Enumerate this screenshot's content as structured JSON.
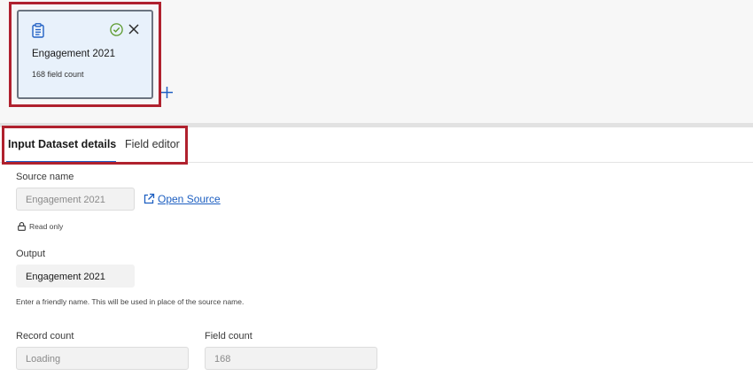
{
  "card": {
    "title": "Engagement 2021",
    "subtitle": "168 field count",
    "status_color": "#5b9a2c",
    "accent": "#2160c4"
  },
  "tabs": [
    {
      "label": "Input Dataset details",
      "active": true
    },
    {
      "label": "Field editor",
      "active": false
    }
  ],
  "form": {
    "source_name_label": "Source name",
    "source_name_value": "Engagement 2021",
    "open_source_label": "Open Source",
    "read_only_label": "Read only",
    "output_label": "Output",
    "output_value": "Engagement 2021",
    "output_hint": "Enter a friendly name. This will be used in place of the source name.",
    "record_count_label": "Record count",
    "record_count_value": "Loading",
    "field_count_label": "Field count",
    "field_count_value": "168"
  },
  "icons": {
    "card_icon": "clipboard-icon",
    "status_icon": "check-circle-icon",
    "close_icon": "close-icon",
    "add_icon": "plus-icon",
    "external_icon": "external-link-icon",
    "lock_icon": "lock-icon"
  },
  "colors": {
    "highlight": "#b0212e",
    "link": "#1d5fc1",
    "card_bg": "#e8f1fb"
  }
}
